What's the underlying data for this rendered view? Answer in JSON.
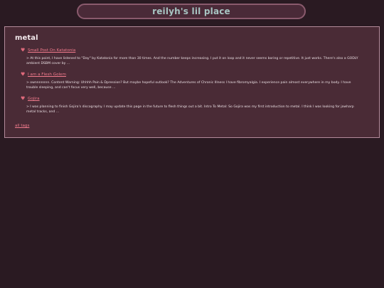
{
  "site": {
    "title": "reilyh's lil place"
  },
  "page": {
    "title": "metal",
    "all_tags_label": "all tags"
  },
  "icons": {
    "bullet": "heart-icon"
  },
  "colors": {
    "background": "#2a1a22",
    "panel": "#4a2b36",
    "header_border": "#8a5a6d",
    "link": "#f07a8c",
    "title_text": "#a7c4c2",
    "heart": "#e06a7c"
  },
  "posts": [
    {
      "title": "Small Post On Katatonia",
      "excerpt": "> At this point, I have listened to \"Day\" by Katatonia for more than 30 times. And the number keeps increasing. I put it on loop and it never seems boring or repetitive. It just works. There's also a GODLY ambient DSBM cover by ..."
    },
    {
      "title": "I am a Flesh Golem",
      "excerpt": "> ownnnnnnn. Content Warning: Uhhhh Pain & Dpression? But maybe hopeful outlook? The Adventures of Chronic Illness I have fibromyalgia. I experience pain almost everywhere in my body. I have trouble sleeping, and can't focus very well, because ..."
    },
    {
      "title": "Gojira",
      "excerpt": "> I was planning to finish Gojira's discography. I may update this page in the future to flesh things out a bit. Intro To Metal: So Gojira was my first introduction to metal. I think I was looking for jawharp metal tracks, and ..."
    }
  ]
}
